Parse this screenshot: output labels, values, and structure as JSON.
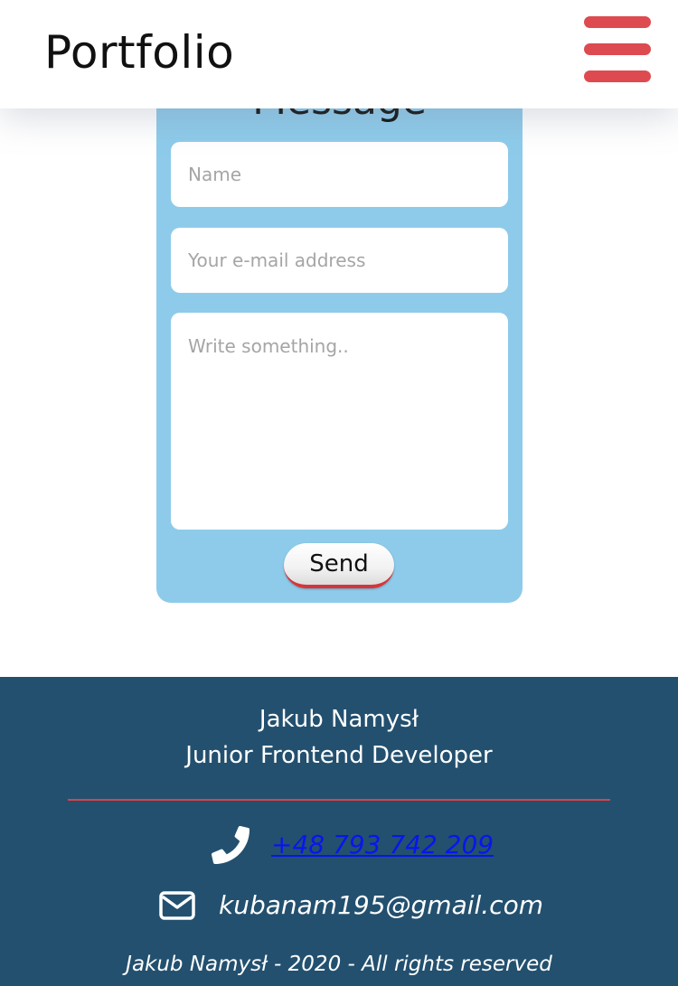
{
  "header": {
    "title": "Portfolio",
    "menu_icon": "hamburger-menu-icon",
    "menu_color": "#dd4b50"
  },
  "contact_form": {
    "heading": "Message",
    "name_placeholder": "Name",
    "email_placeholder": "Your e-mail address",
    "message_placeholder": "Write something..",
    "send_label": "Send",
    "card_color": "#8ecbea"
  },
  "footer": {
    "name": "Jakub Namysł",
    "role": "Junior Frontend Developer",
    "phone": "+48 793 742 209",
    "phone_icon": "phone-icon",
    "email": "kubanam195@gmail.com",
    "email_icon": "envelope-icon",
    "copyright": "Jakub Namysł - 2020 - All rights reserved",
    "background_color": "#23506f",
    "divider_color": "#d8434a",
    "link_color": "#0a15ee"
  }
}
